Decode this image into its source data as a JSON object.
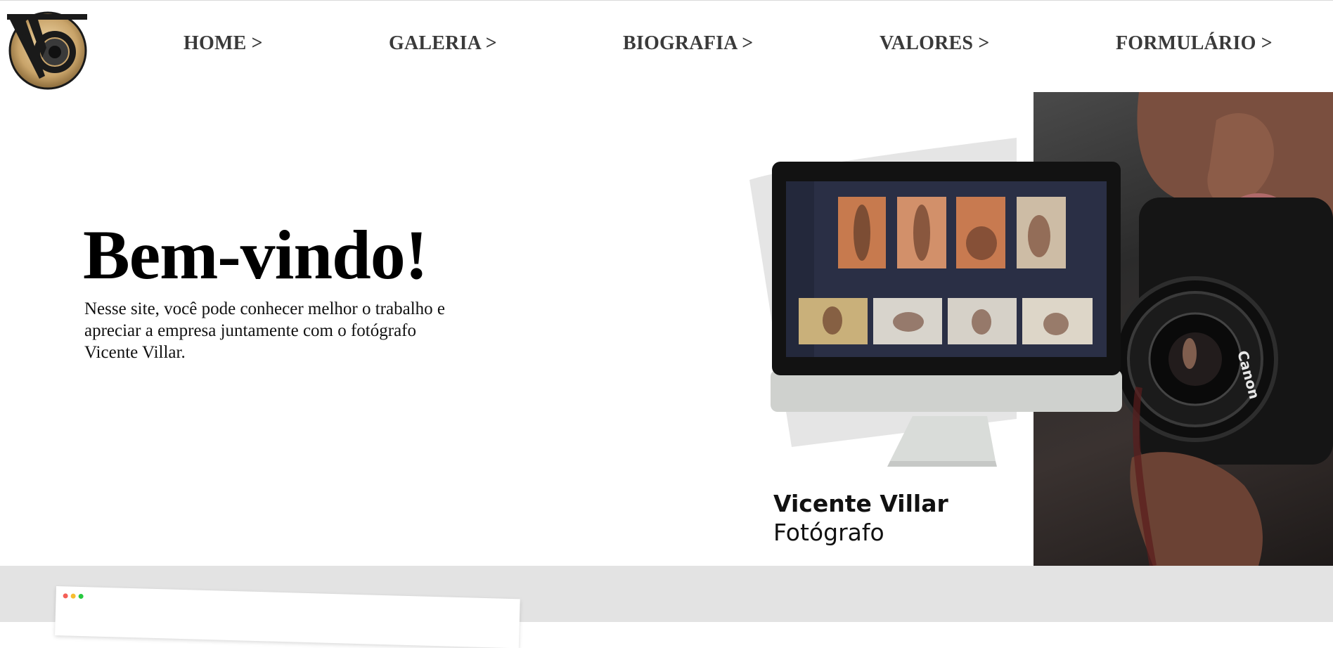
{
  "logo": {
    "text": "V",
    "icon": "vv-camera-logo"
  },
  "nav": [
    {
      "label": "HOME >"
    },
    {
      "label": "GALERIA >"
    },
    {
      "label": "BIOGRAFIA >"
    },
    {
      "label": "VALORES >"
    },
    {
      "label": "FORMULÁRIO >"
    }
  ],
  "hero": {
    "title": "Bem-vindo!",
    "text": "Nesse site, você pode conhecer melhor o trabalho e apreciar a empresa juntamente com o fotógrafo Vicente Villar."
  },
  "photographer": {
    "name": "Vicente Villar",
    "role": "Fotógrafo"
  },
  "camera_brand": "Canon",
  "colors": {
    "nav_text": "#3a3a3a",
    "gold": "#c9a46a",
    "bottom_bg": "#e3e3e3",
    "photo_bg": "#2b2b2b"
  }
}
